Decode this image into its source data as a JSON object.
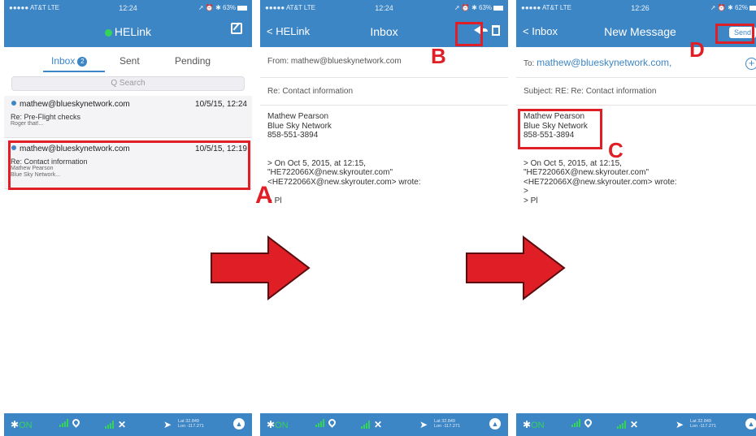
{
  "colors": {
    "header_blue": "#3d86c6",
    "annotation_red": "#e01e25",
    "online_green": "#35d35a"
  },
  "status_bar": {
    "carrier": "●●●●● AT&T LTE",
    "p1": {
      "time": "12:24",
      "right": "➚ ⏰ ✱ 63%"
    },
    "p2": {
      "time": "12:24",
      "right": "➚ ⏰ ✱ 63%"
    },
    "p3": {
      "time": "12:26",
      "right": "➚ ⏰ ✱ 62%"
    }
  },
  "screen1": {
    "title": "HELink",
    "compose_icon": "compose-icon",
    "tabs": [
      {
        "label": "Inbox",
        "badge": "2"
      },
      {
        "label": "Sent"
      },
      {
        "label": "Pending"
      }
    ],
    "search_placeholder": "Q Search",
    "messages": [
      {
        "from": "mathew@blueskynetwork.com",
        "date": "10/5/15, 12:24",
        "subject": "Re: Pre-Flight checks",
        "preview1": "Roger that!...",
        "preview2": ""
      },
      {
        "from": "mathew@blueskynetwork.com",
        "date": "10/5/15, 12:19",
        "subject": "Re: Contact information",
        "preview1": "Mathew Pearson",
        "preview2": "Blue Sky Network..."
      }
    ]
  },
  "screen2": {
    "back_label": "HELink",
    "title": "Inbox",
    "from_label": "From:",
    "from_value": "mathew@blueskynetwork.com",
    "subject": "Re: Contact information",
    "body": [
      "Mathew Pearson",
      "Blue Sky Network",
      "858-551-3894",
      "",
      "",
      "> On Oct 5, 2015, at 12:15,",
      "\"HE722066X@new.skyrouter.com\"",
      "<HE722066X@new.skyrouter.com> wrote:",
      "",
      "> Pl"
    ]
  },
  "screen3": {
    "back_label": "Inbox",
    "title": "New Message",
    "send_label": "Send",
    "to_label": "To:",
    "to_value": "mathew@blueskynetwork.com,",
    "subject_label": "Subject:",
    "subject_value": "RE: Re: Contact information",
    "body": [
      "Mathew Pearson",
      "Blue Sky Network",
      "858-551-3894",
      "",
      "",
      "> On Oct 5, 2015, at 12:15,",
      "\"HE722066X@new.skyrouter.com\"",
      "<HE722066X@new.skyrouter.com> wrote:",
      ">",
      "> Pl"
    ]
  },
  "bottom_bar": {
    "bt_on": "ON",
    "lat": "Lat 32.849",
    "lon": "Lon -117.271"
  },
  "annotations": {
    "a": "A",
    "b": "B",
    "c": "C",
    "d": "D"
  }
}
